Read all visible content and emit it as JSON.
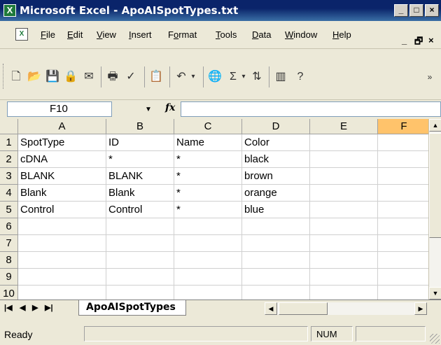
{
  "window": {
    "title": "Microsoft Excel - ApoAISpotTypes.txt",
    "minimize": "_",
    "maximize": "□",
    "close": "×"
  },
  "menu": {
    "items": [
      {
        "label": "File",
        "key": "F",
        "rest": "ile"
      },
      {
        "label": "Edit",
        "key": "E",
        "rest": "dit"
      },
      {
        "label": "View",
        "key": "V",
        "rest": "iew"
      },
      {
        "label": "Insert",
        "key": "I",
        "rest": "nsert"
      },
      {
        "label": "Format",
        "key": "o",
        "pre": "F",
        "rest": "rmat"
      },
      {
        "label": "Tools",
        "key": "T",
        "rest": "ools"
      },
      {
        "label": "Data",
        "key": "D",
        "rest": "ata"
      },
      {
        "label": "Window",
        "key": "W",
        "rest": "indow"
      },
      {
        "label": "Help",
        "key": "H",
        "rest": "elp"
      }
    ],
    "doc_minimize": "_",
    "doc_restore": "🗗",
    "doc_close": "×"
  },
  "toolbar": {
    "icons": [
      "new-icon",
      "open-icon",
      "save-icon",
      "permission-icon",
      "email-icon",
      "print-icon",
      "spelling-icon",
      "paste-icon",
      "undo-icon",
      "hyperlink-icon",
      "autosum-icon",
      "sort-ascending-icon",
      "chart-wizard-icon",
      "help-icon",
      "toolbar-options-icon"
    ]
  },
  "formula_bar": {
    "name_box": "F10",
    "fx_label": "fx",
    "formula": ""
  },
  "grid": {
    "columns": [
      "A",
      "B",
      "C",
      "D",
      "E",
      "F"
    ],
    "selected_column": "F",
    "row_numbers": [
      "1",
      "2",
      "3",
      "4",
      "5",
      "6",
      "7",
      "8",
      "9",
      "10"
    ],
    "rows": [
      [
        "SpotType",
        "ID",
        "Name",
        "Color",
        "",
        ""
      ],
      [
        "cDNA",
        "*",
        "*",
        "black",
        "",
        ""
      ],
      [
        "BLANK",
        "BLANK",
        "*",
        "brown",
        "",
        ""
      ],
      [
        "Blank",
        "Blank",
        "*",
        "orange",
        "",
        ""
      ],
      [
        "Control",
        "Control",
        "*",
        "blue",
        "",
        ""
      ],
      [
        "",
        "",
        "",
        "",
        "",
        ""
      ],
      [
        "",
        "",
        "",
        "",
        "",
        ""
      ],
      [
        "",
        "",
        "",
        "",
        "",
        ""
      ],
      [
        "",
        "",
        "",
        "",
        "",
        ""
      ],
      [
        "",
        "",
        "",
        "",
        "",
        ""
      ]
    ]
  },
  "sheet_tabs": {
    "active": "ApoAISpotTypes"
  },
  "status_bar": {
    "status": "Ready",
    "num_lock": "NUM"
  }
}
